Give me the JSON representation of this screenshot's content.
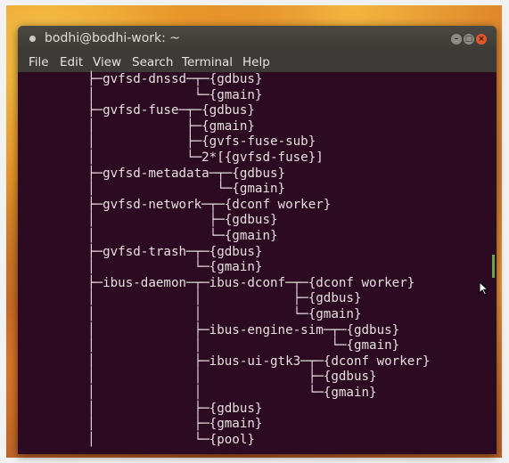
{
  "window": {
    "title": "bodhi@bodhi-work: ~",
    "buttons": {
      "minimize": "–",
      "maximize": "□",
      "close": "×"
    }
  },
  "menu": {
    "file": "File",
    "edit": "Edit",
    "view": "View",
    "search": "Search",
    "terminal": "Terminal",
    "help": "Help"
  },
  "terminal": {
    "lines": [
      "├─gvfsd-dnssd─┬─{gdbus}",
      "│             └─{gmain}",
      "├─gvfsd-fuse─┬─{gdbus}",
      "│            ├─{gmain}",
      "│            ├─{gvfs-fuse-sub}",
      "│            └─2*[{gvfsd-fuse}]",
      "├─gvfsd-metadata─┬─{gdbus}",
      "│                └─{gmain}",
      "├─gvfsd-network─┬─{dconf worker}",
      "│               ├─{gdbus}",
      "│               └─{gmain}",
      "├─gvfsd-trash─┬─{gdbus}",
      "│             └─{gmain}",
      "├─ibus-daemon─┬─ibus-dconf─┬─{dconf worker}",
      "│             │            ├─{gdbus}",
      "│             │            └─{gmain}",
      "│             ├─ibus-engine-sim─┬─{gdbus}",
      "│             │                 └─{gmain}",
      "│             ├─ibus-ui-gtk3─┬─{dconf worker}",
      "│             │              ├─{gdbus}",
      "│             │              └─{gmain}",
      "│             ├─{gdbus}",
      "│             ├─{gmain}",
      "│             └─{pool}"
    ]
  },
  "colors": {
    "terminal_background": "#2c0a22",
    "terminal_text": "#e6e1dc",
    "titlebar": "#3b3a35",
    "close_button": "#e2572c",
    "scroll_indicator": "#6aa545"
  },
  "icons": {
    "window_menu": "dot-icon",
    "mouse_cursor": "arrow-cursor-icon"
  }
}
